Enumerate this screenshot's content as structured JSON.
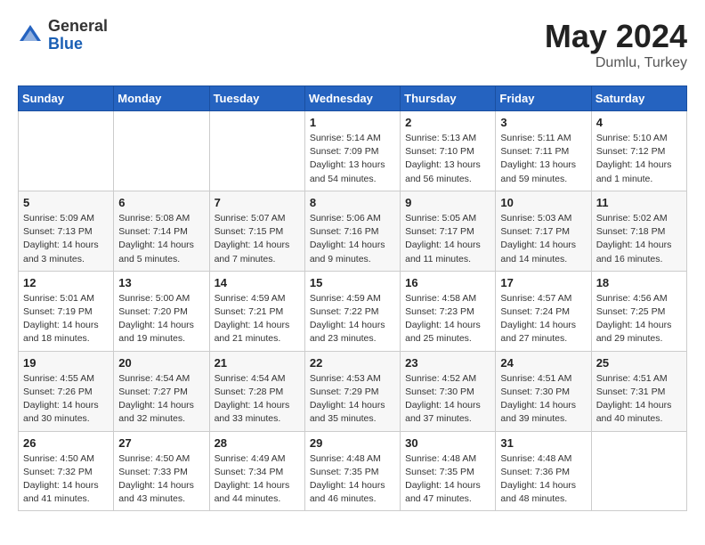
{
  "logo": {
    "general": "General",
    "blue": "Blue"
  },
  "title": {
    "month_year": "May 2024",
    "location": "Dumlu, Turkey"
  },
  "weekdays": [
    "Sunday",
    "Monday",
    "Tuesday",
    "Wednesday",
    "Thursday",
    "Friday",
    "Saturday"
  ],
  "weeks": [
    [
      null,
      null,
      null,
      {
        "day": 1,
        "sunrise": "Sunrise: 5:14 AM",
        "sunset": "Sunset: 7:09 PM",
        "daylight": "Daylight: 13 hours and 54 minutes."
      },
      {
        "day": 2,
        "sunrise": "Sunrise: 5:13 AM",
        "sunset": "Sunset: 7:10 PM",
        "daylight": "Daylight: 13 hours and 56 minutes."
      },
      {
        "day": 3,
        "sunrise": "Sunrise: 5:11 AM",
        "sunset": "Sunset: 7:11 PM",
        "daylight": "Daylight: 13 hours and 59 minutes."
      },
      {
        "day": 4,
        "sunrise": "Sunrise: 5:10 AM",
        "sunset": "Sunset: 7:12 PM",
        "daylight": "Daylight: 14 hours and 1 minute."
      }
    ],
    [
      {
        "day": 5,
        "sunrise": "Sunrise: 5:09 AM",
        "sunset": "Sunset: 7:13 PM",
        "daylight": "Daylight: 14 hours and 3 minutes."
      },
      {
        "day": 6,
        "sunrise": "Sunrise: 5:08 AM",
        "sunset": "Sunset: 7:14 PM",
        "daylight": "Daylight: 14 hours and 5 minutes."
      },
      {
        "day": 7,
        "sunrise": "Sunrise: 5:07 AM",
        "sunset": "Sunset: 7:15 PM",
        "daylight": "Daylight: 14 hours and 7 minutes."
      },
      {
        "day": 8,
        "sunrise": "Sunrise: 5:06 AM",
        "sunset": "Sunset: 7:16 PM",
        "daylight": "Daylight: 14 hours and 9 minutes."
      },
      {
        "day": 9,
        "sunrise": "Sunrise: 5:05 AM",
        "sunset": "Sunset: 7:17 PM",
        "daylight": "Daylight: 14 hours and 11 minutes."
      },
      {
        "day": 10,
        "sunrise": "Sunrise: 5:03 AM",
        "sunset": "Sunset: 7:17 PM",
        "daylight": "Daylight: 14 hours and 14 minutes."
      },
      {
        "day": 11,
        "sunrise": "Sunrise: 5:02 AM",
        "sunset": "Sunset: 7:18 PM",
        "daylight": "Daylight: 14 hours and 16 minutes."
      }
    ],
    [
      {
        "day": 12,
        "sunrise": "Sunrise: 5:01 AM",
        "sunset": "Sunset: 7:19 PM",
        "daylight": "Daylight: 14 hours and 18 minutes."
      },
      {
        "day": 13,
        "sunrise": "Sunrise: 5:00 AM",
        "sunset": "Sunset: 7:20 PM",
        "daylight": "Daylight: 14 hours and 19 minutes."
      },
      {
        "day": 14,
        "sunrise": "Sunrise: 4:59 AM",
        "sunset": "Sunset: 7:21 PM",
        "daylight": "Daylight: 14 hours and 21 minutes."
      },
      {
        "day": 15,
        "sunrise": "Sunrise: 4:59 AM",
        "sunset": "Sunset: 7:22 PM",
        "daylight": "Daylight: 14 hours and 23 minutes."
      },
      {
        "day": 16,
        "sunrise": "Sunrise: 4:58 AM",
        "sunset": "Sunset: 7:23 PM",
        "daylight": "Daylight: 14 hours and 25 minutes."
      },
      {
        "day": 17,
        "sunrise": "Sunrise: 4:57 AM",
        "sunset": "Sunset: 7:24 PM",
        "daylight": "Daylight: 14 hours and 27 minutes."
      },
      {
        "day": 18,
        "sunrise": "Sunrise: 4:56 AM",
        "sunset": "Sunset: 7:25 PM",
        "daylight": "Daylight: 14 hours and 29 minutes."
      }
    ],
    [
      {
        "day": 19,
        "sunrise": "Sunrise: 4:55 AM",
        "sunset": "Sunset: 7:26 PM",
        "daylight": "Daylight: 14 hours and 30 minutes."
      },
      {
        "day": 20,
        "sunrise": "Sunrise: 4:54 AM",
        "sunset": "Sunset: 7:27 PM",
        "daylight": "Daylight: 14 hours and 32 minutes."
      },
      {
        "day": 21,
        "sunrise": "Sunrise: 4:54 AM",
        "sunset": "Sunset: 7:28 PM",
        "daylight": "Daylight: 14 hours and 33 minutes."
      },
      {
        "day": 22,
        "sunrise": "Sunrise: 4:53 AM",
        "sunset": "Sunset: 7:29 PM",
        "daylight": "Daylight: 14 hours and 35 minutes."
      },
      {
        "day": 23,
        "sunrise": "Sunrise: 4:52 AM",
        "sunset": "Sunset: 7:30 PM",
        "daylight": "Daylight: 14 hours and 37 minutes."
      },
      {
        "day": 24,
        "sunrise": "Sunrise: 4:51 AM",
        "sunset": "Sunset: 7:30 PM",
        "daylight": "Daylight: 14 hours and 39 minutes."
      },
      {
        "day": 25,
        "sunrise": "Sunrise: 4:51 AM",
        "sunset": "Sunset: 7:31 PM",
        "daylight": "Daylight: 14 hours and 40 minutes."
      }
    ],
    [
      {
        "day": 26,
        "sunrise": "Sunrise: 4:50 AM",
        "sunset": "Sunset: 7:32 PM",
        "daylight": "Daylight: 14 hours and 41 minutes."
      },
      {
        "day": 27,
        "sunrise": "Sunrise: 4:50 AM",
        "sunset": "Sunset: 7:33 PM",
        "daylight": "Daylight: 14 hours and 43 minutes."
      },
      {
        "day": 28,
        "sunrise": "Sunrise: 4:49 AM",
        "sunset": "Sunset: 7:34 PM",
        "daylight": "Daylight: 14 hours and 44 minutes."
      },
      {
        "day": 29,
        "sunrise": "Sunrise: 4:48 AM",
        "sunset": "Sunset: 7:35 PM",
        "daylight": "Daylight: 14 hours and 46 minutes."
      },
      {
        "day": 30,
        "sunrise": "Sunrise: 4:48 AM",
        "sunset": "Sunset: 7:35 PM",
        "daylight": "Daylight: 14 hours and 47 minutes."
      },
      {
        "day": 31,
        "sunrise": "Sunrise: 4:48 AM",
        "sunset": "Sunset: 7:36 PM",
        "daylight": "Daylight: 14 hours and 48 minutes."
      },
      null
    ]
  ]
}
